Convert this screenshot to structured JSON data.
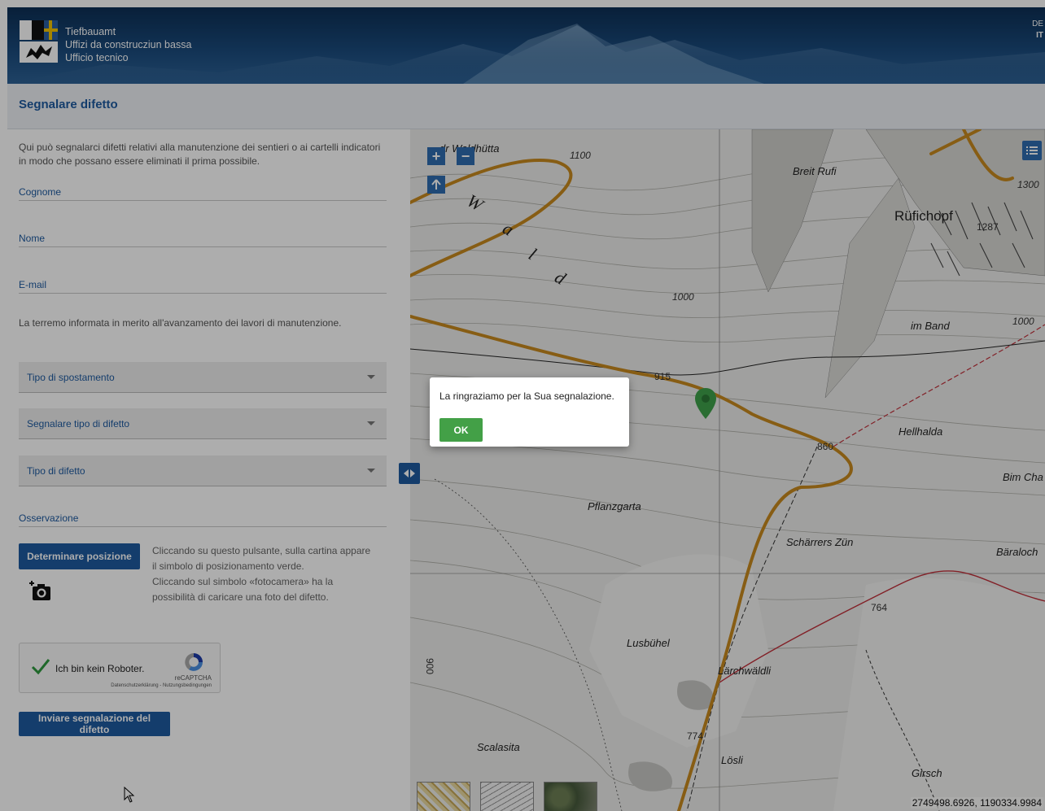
{
  "header": {
    "brand_lines": [
      "Tiefbauamt",
      "Uffizi da construcziun bassa",
      "Ufficio tecnico"
    ],
    "languages": [
      "DE",
      "IT"
    ],
    "active_language": "IT"
  },
  "page": {
    "title": "Segnalare difetto"
  },
  "form": {
    "intro": "Qui può segnalarci difetti relativi alla manutenzione dei sentieri o ai cartelli indicatori in modo che possano essere eliminati il prima possibile.",
    "fields": {
      "cognome": "Cognome",
      "nome": "Nome",
      "email": "E-mail"
    },
    "info_text": "La terremo informata in merito all'avanzamento dei lavori di manutenzione.",
    "selects": {
      "tipo_spostamento": "Tipo di spostamento",
      "segnalare_tipo": "Segnalare tipo di difetto",
      "tipo_difetto": "Tipo di difetto"
    },
    "osservazione": "Osservazione",
    "position_button": "Determinare posizione",
    "help_position": "Cliccando su questo pulsante, sulla cartina appare il simbolo di posizionamento verde.",
    "help_camera": "Cliccando sul simbolo «fotocamera» ha la possibilità di caricare una foto del difetto.",
    "captcha": {
      "label": "Ich bin kein Roboter.",
      "brand": "reCAPTCHA",
      "links": "Datenschutzerklärung - Nutzungsbedingungen",
      "checked": true
    },
    "submit_button": "Inviare segnalazione del difetto"
  },
  "map": {
    "labels": {
      "waldhuetta": "dr Waldhütta",
      "breit_rufi": "Breit Rufi",
      "rufichopf": "Rüfichopf",
      "im_band": "im Band",
      "hellhalda": "Hellhalda",
      "bim_cha": "Bim Cha",
      "pflanzgarta": "Pflanzgarta",
      "scharrers_zun": "Schärrers Zün",
      "baraloch": "Bäraloch",
      "lusbuhel": "Lusbühel",
      "larchwaldli": "Lärchwäldli",
      "scalasita": "Scalasita",
      "losli": "Lösli",
      "girsch": "Girsch"
    },
    "elevations": [
      "1100",
      "1000",
      "1000",
      "1300",
      "1287",
      "915",
      "860",
      "764",
      "774",
      "900"
    ],
    "coordinates": "2749498.6926, 1190334.9984",
    "zoom_in": "+",
    "zoom_out": "−"
  },
  "dialog": {
    "message": "La ringraziamo per la Sua segnalazione.",
    "ok_label": "OK"
  },
  "colors": {
    "primary": "#1e5aa0",
    "ok_green": "#43a047",
    "marker_green": "#3fa14a",
    "trail_orange": "#c8891e"
  }
}
